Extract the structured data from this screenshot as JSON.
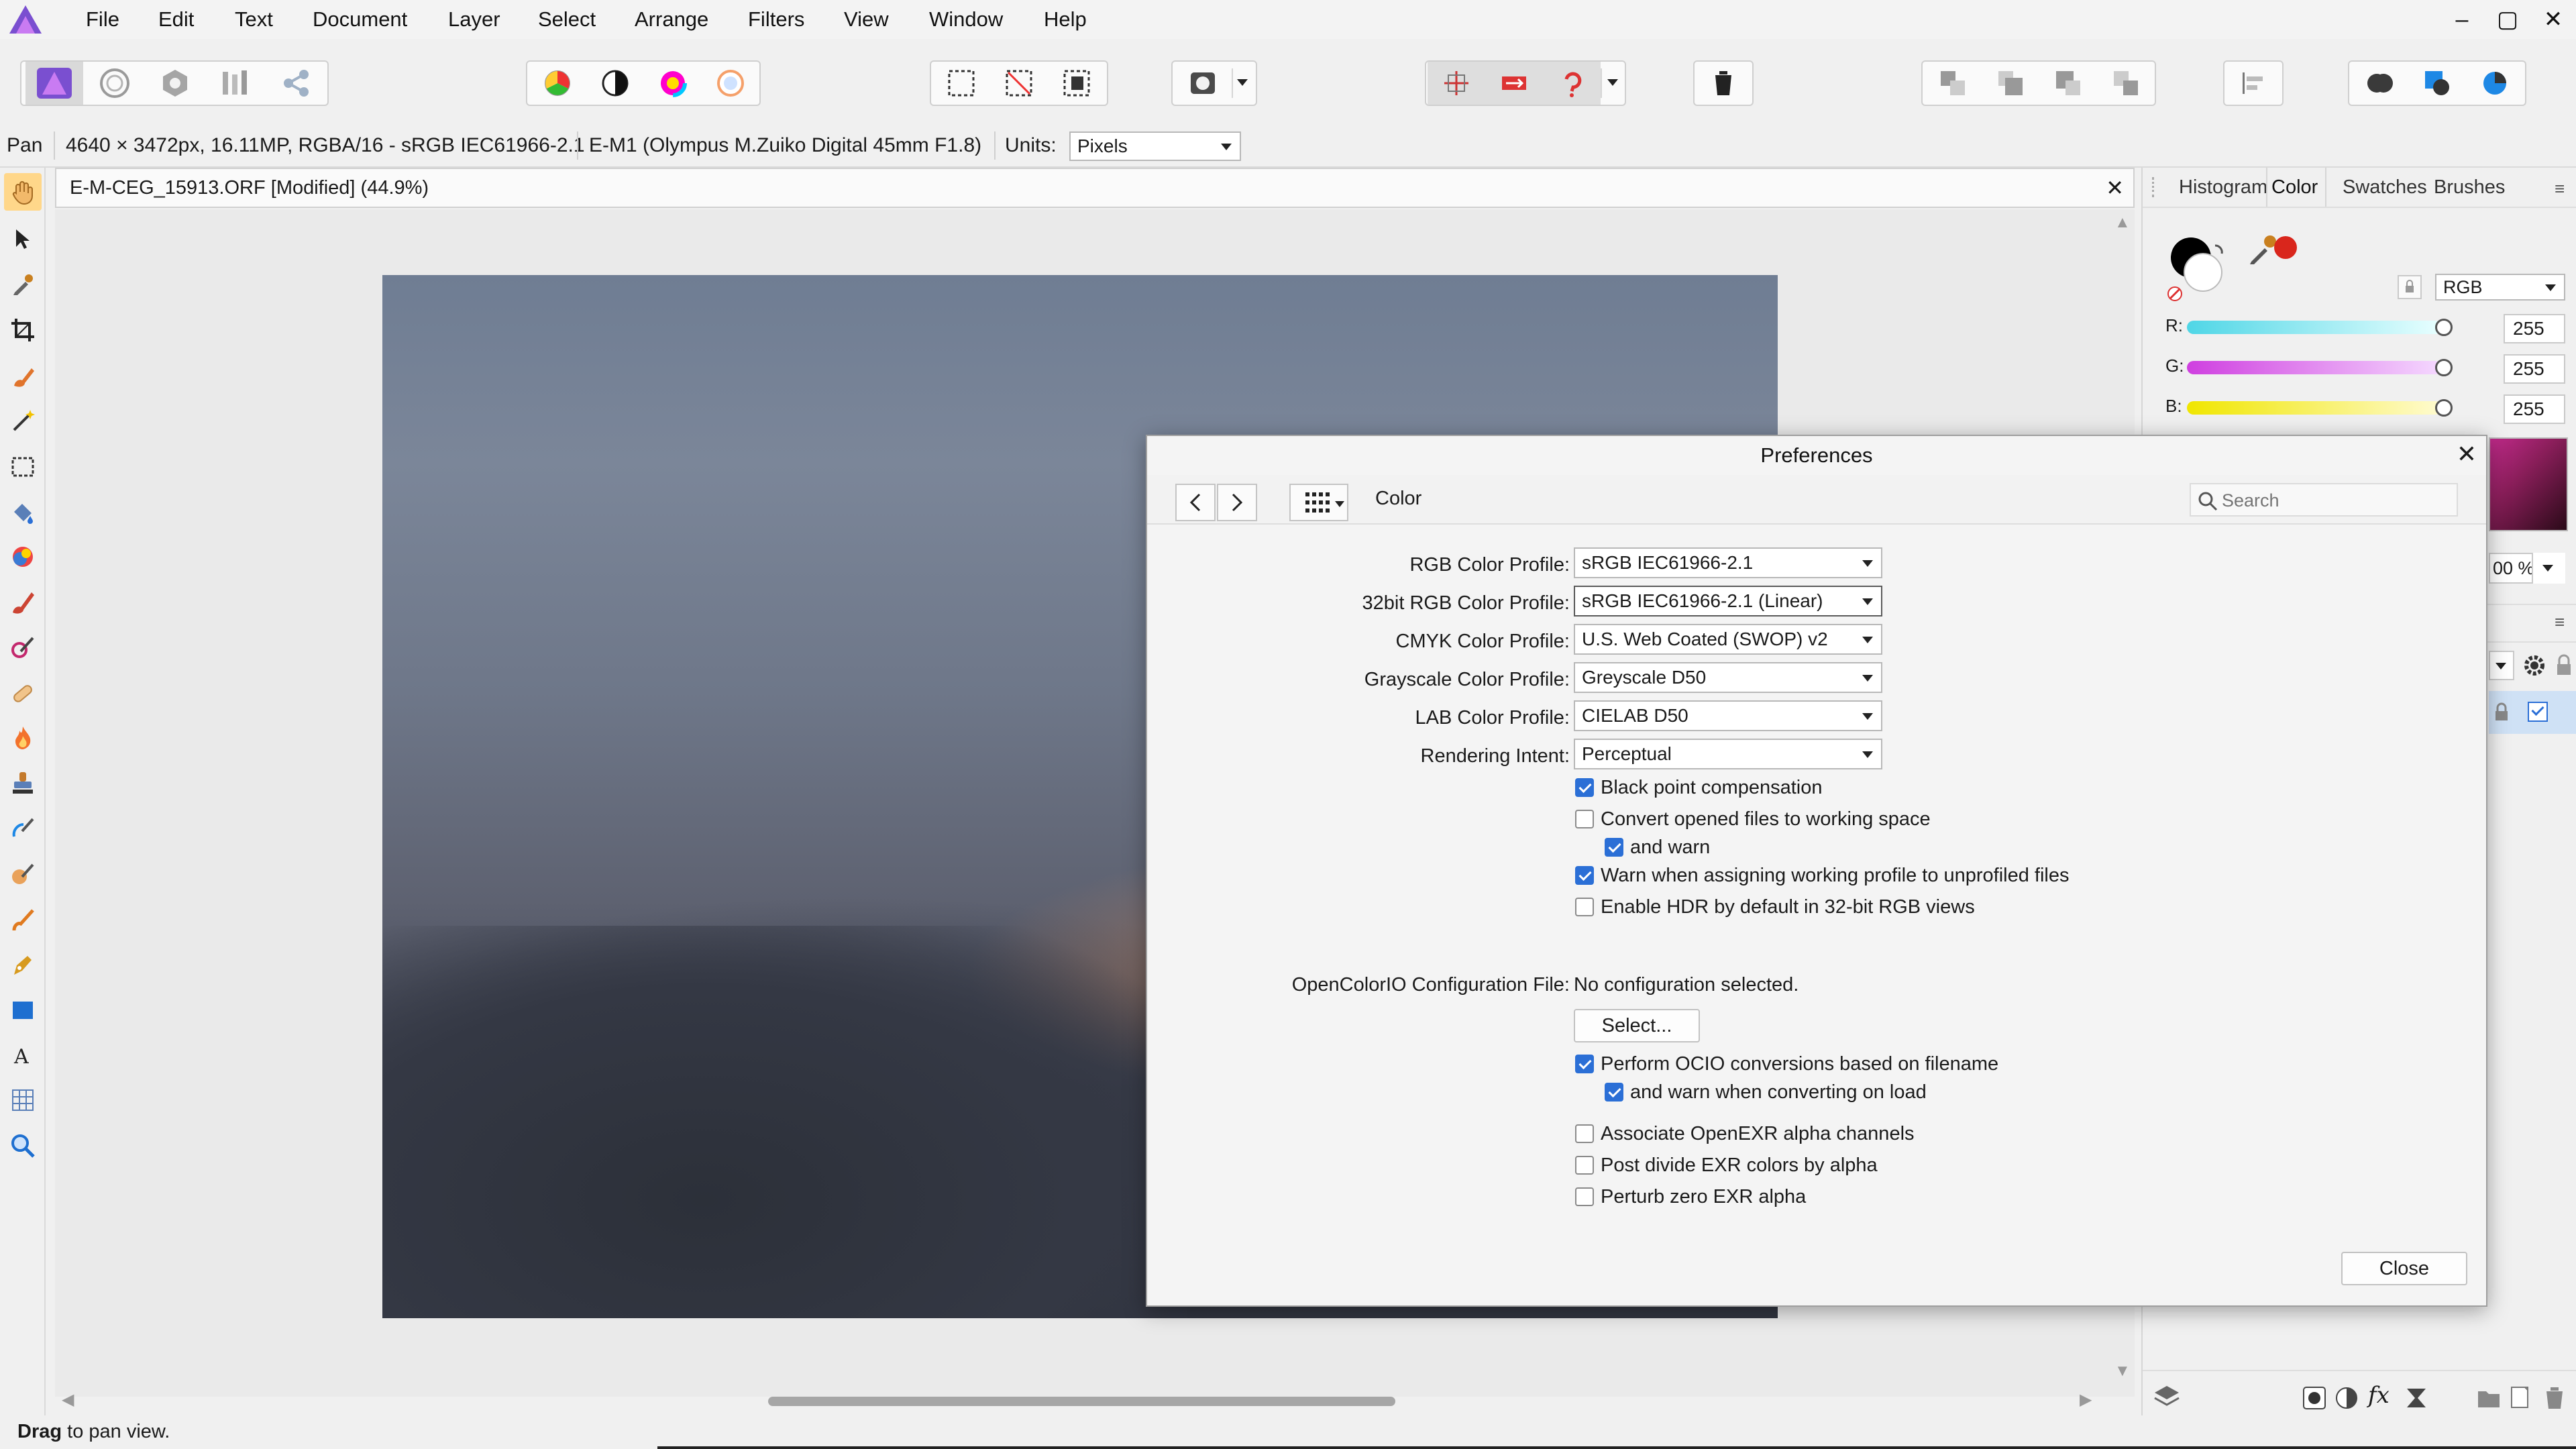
{
  "menubar": {
    "items": [
      "File",
      "Edit",
      "Text",
      "Document",
      "Layer",
      "Select",
      "Arrange",
      "Filters",
      "View",
      "Window",
      "Help"
    ],
    "window_controls": [
      "–",
      "▢",
      "✕"
    ]
  },
  "context": {
    "tool_name": "Pan",
    "image_info": "4640 × 3472px, 16.11MP, RGBA/16 - sRGB IEC61966-2.1",
    "camera_info": "E-M1 (Olympus M.Zuiko Digital 45mm F1.8)",
    "units_label": "Units:",
    "units_value": "Pixels"
  },
  "document": {
    "tab_title": "E-M-CEG_15913.ORF [Modified] (44.9%)",
    "close": "✕"
  },
  "right_panel": {
    "tabs": [
      "Histogram",
      "Color",
      "Swatches",
      "Brushes"
    ],
    "active_tab": "Color",
    "color_model": "RGB",
    "sliders": [
      {
        "label": "R:",
        "value": "255",
        "color": "#4fd6e6"
      },
      {
        "label": "G:",
        "value": "255",
        "color": "#cf3fe0"
      },
      {
        "label": "B:",
        "value": "255",
        "color": "#f0e600"
      }
    ],
    "opacity_partial": "00 %",
    "accent_swatch": "#d9261c"
  },
  "dialog": {
    "title": "Preferences",
    "section": "Color",
    "search_placeholder": "Search",
    "profiles": [
      {
        "label": "RGB Color Profile:",
        "value": "sRGB IEC61966-2.1"
      },
      {
        "label": "32bit RGB Color Profile:",
        "value": "sRGB IEC61966-2.1 (Linear)"
      },
      {
        "label": "CMYK Color Profile:",
        "value": "U.S. Web Coated (SWOP) v2"
      },
      {
        "label": "Grayscale Color Profile:",
        "value": "Greyscale D50"
      },
      {
        "label": "LAB Color Profile:",
        "value": "CIELAB D50"
      },
      {
        "label": "Rendering Intent:",
        "value": "Perceptual"
      }
    ],
    "checkboxes": [
      {
        "label": "Black point compensation",
        "checked": true
      },
      {
        "label": "Convert opened files to working space",
        "checked": false
      },
      {
        "label": "and warn",
        "checked": true
      },
      {
        "label": "Warn when assigning working profile to unprofiled files",
        "checked": true
      },
      {
        "label": "Enable HDR by default in 32-bit RGB views",
        "checked": false
      }
    ],
    "ocio_label": "OpenColorIO Configuration File:",
    "ocio_value": "No configuration selected.",
    "select_button": "Select...",
    "ocio_checkboxes": [
      {
        "label": "Perform OCIO conversions based on filename",
        "checked": true
      },
      {
        "label": "and warn when converting on load",
        "checked": true
      },
      {
        "label": "Associate OpenEXR alpha channels",
        "checked": false
      },
      {
        "label": "Post divide EXR colors by alpha",
        "checked": false
      },
      {
        "label": "Perturb zero EXR alpha",
        "checked": false
      }
    ],
    "close_button": "Close"
  },
  "status": {
    "bold": "Drag",
    "rest": " to pan view."
  }
}
